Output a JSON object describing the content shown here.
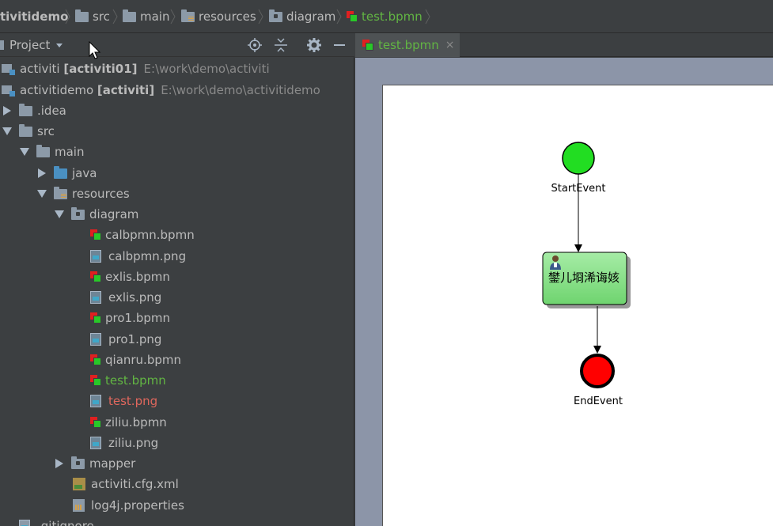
{
  "breadcrumb": {
    "items": [
      {
        "label": "tivitidemo",
        "icon": "none"
      },
      {
        "label": "src",
        "icon": "folder-icon"
      },
      {
        "label": "main",
        "icon": "folder-icon"
      },
      {
        "label": "resources",
        "icon": "resources-folder-icon"
      },
      {
        "label": "diagram",
        "icon": "package-folder-icon"
      },
      {
        "label": "test.bpmn",
        "icon": "bpmn-file-icon"
      }
    ]
  },
  "project_panel": {
    "title": "Project",
    "buttons": [
      "locate-icon",
      "collapse-all-icon",
      "gear-icon",
      "minimize-icon"
    ]
  },
  "tree": {
    "rows": [
      {
        "name": "activiti",
        "bold": "[activiti01]",
        "path": "E:\\work\\demo\\activiti"
      },
      {
        "name": "activitidemo",
        "bold": "[activiti]",
        "path": "E:\\work\\demo\\activitidemo"
      },
      {
        "label": ".idea"
      },
      {
        "label": "src"
      },
      {
        "label": "main"
      },
      {
        "label": "java"
      },
      {
        "label": "resources"
      },
      {
        "label": "diagram"
      },
      {
        "label": "calbpmn.bpmn"
      },
      {
        "label": "calbpmn.png"
      },
      {
        "label": "exlis.bpmn"
      },
      {
        "label": "exlis.png"
      },
      {
        "label": "pro1.bpmn"
      },
      {
        "label": "pro1.png"
      },
      {
        "label": "qianru.bpmn"
      },
      {
        "label": "test.bpmn",
        "status": "added"
      },
      {
        "label": "test.png",
        "status": "unversioned"
      },
      {
        "label": "ziliu.bpmn"
      },
      {
        "label": "ziliu.png"
      },
      {
        "label": "mapper"
      },
      {
        "label": "activiti.cfg.xml"
      },
      {
        "label": "log4j.properties"
      },
      {
        "label": ".gitignore"
      }
    ]
  },
  "editor": {
    "tab_label": "test.bpmn",
    "close_glyph": "×"
  },
  "diagram": {
    "start_label": "StartEvent",
    "task_label": "鐢儿埛浠诲姟",
    "end_label": "EndEvent",
    "colors": {
      "start": "#22dd22",
      "task": "#90e490",
      "end": "#ff0000"
    }
  }
}
